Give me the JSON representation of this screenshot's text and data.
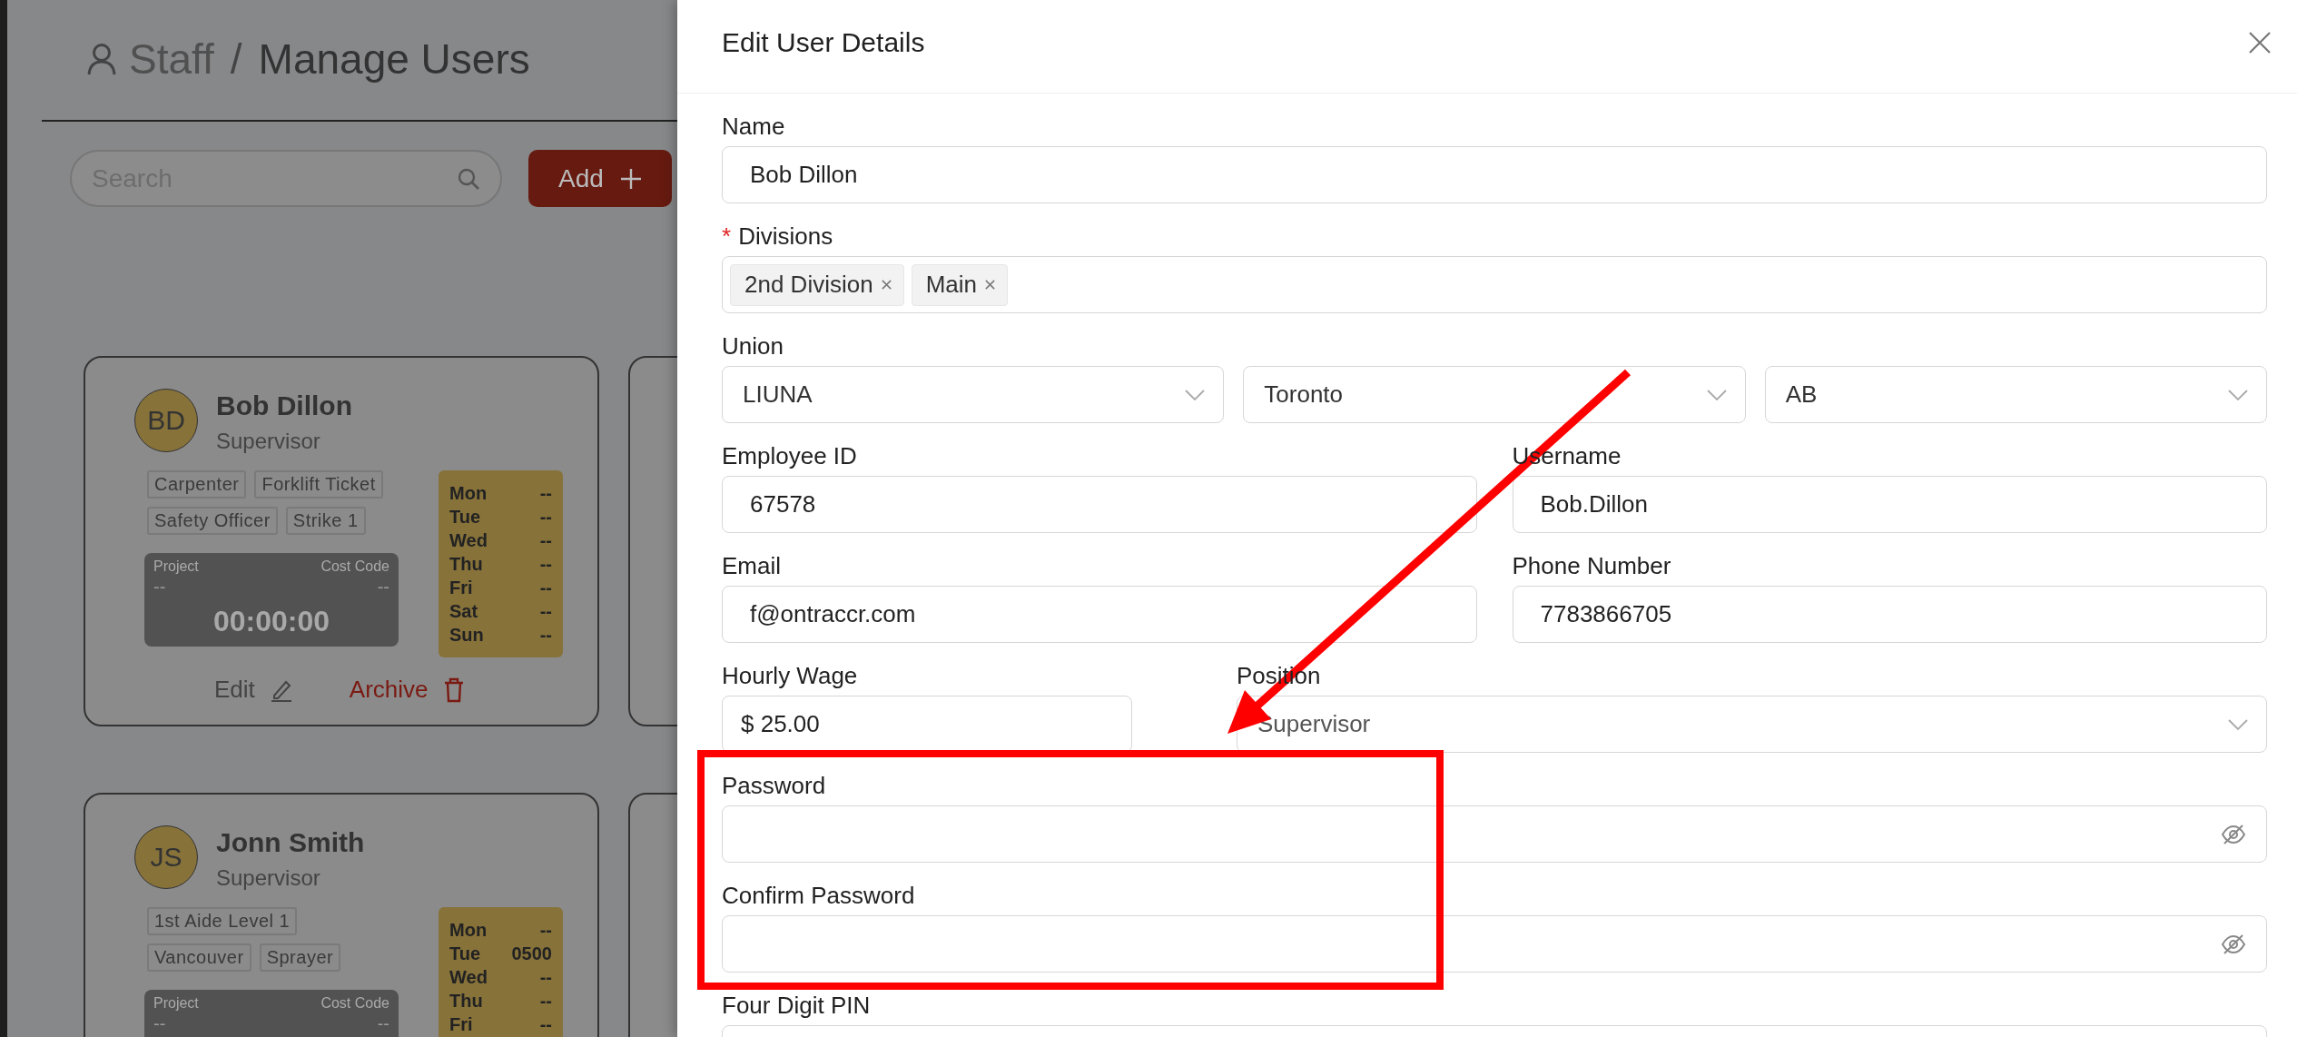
{
  "breadcrumb": {
    "section": "Staff",
    "separator": "/",
    "page": "Manage Users"
  },
  "search": {
    "placeholder": "Search"
  },
  "add_button": {
    "label": "Add"
  },
  "users": [
    {
      "initials": "BD",
      "name": "Bob Dillon",
      "role": "Supervisor",
      "tags": [
        [
          "Carpenter",
          "Forklift Ticket"
        ],
        [
          "Safety Officer",
          "Strike 1"
        ]
      ],
      "timer": {
        "project_label": "Project",
        "project": "--",
        "cost_code_label": "Cost Code",
        "cost_code": "--",
        "time": "00:00:00"
      },
      "schedule": [
        {
          "day": "Mon",
          "value": "--"
        },
        {
          "day": "Tue",
          "value": "--"
        },
        {
          "day": "Wed",
          "value": "--"
        },
        {
          "day": "Thu",
          "value": "--"
        },
        {
          "day": "Fri",
          "value": "--"
        },
        {
          "day": "Sat",
          "value": "--"
        },
        {
          "day": "Sun",
          "value": "--"
        }
      ],
      "actions": {
        "edit": "Edit",
        "archive": "Archive"
      }
    },
    {
      "initials": "JS",
      "name": "Jonn Smith",
      "role": "Supervisor",
      "tags": [
        [
          "1st Aide Level 1"
        ],
        [
          "Vancouver",
          "Sprayer"
        ]
      ],
      "timer": {
        "project_label": "Project",
        "project": "--",
        "cost_code_label": "Cost Code",
        "cost_code": "--"
      },
      "schedule": [
        {
          "day": "Mon",
          "value": "--"
        },
        {
          "day": "Tue",
          "value": "0500"
        },
        {
          "day": "Wed",
          "value": "--"
        },
        {
          "day": "Thu",
          "value": "--"
        },
        {
          "day": "Fri",
          "value": "--"
        }
      ]
    }
  ],
  "drawer": {
    "title": "Edit User Details",
    "rows": [
      {
        "cells": [
          {
            "kind": "text",
            "label": "Name",
            "value": "Bob Dillon"
          }
        ]
      },
      {
        "cells": [
          {
            "kind": "tags",
            "label": "Divisions",
            "required_mark": "*",
            "tags": [
              "2nd Division",
              "Main"
            ]
          }
        ]
      },
      {
        "cells": [
          {
            "kind": "select_group",
            "label": "Union",
            "values": [
              "LIUNA",
              "Toronto",
              "AB"
            ]
          }
        ]
      },
      {
        "cells": [
          {
            "kind": "text",
            "label": "Employee ID",
            "value": "67578"
          },
          {
            "kind": "text",
            "label": "Username",
            "value": "Bob.Dillon"
          }
        ]
      },
      {
        "cells": [
          {
            "kind": "text",
            "label": "Email",
            "value": "f@ontraccr.com"
          },
          {
            "kind": "text",
            "label": "Phone Number",
            "value": "7783866705"
          }
        ]
      },
      {
        "cells": [
          {
            "kind": "currency",
            "label": "Hourly Wage",
            "prefix": "$",
            "value": "25.00"
          },
          {
            "kind": "select",
            "label": "Position",
            "value": "Supervisor"
          }
        ]
      },
      {
        "cells": [
          {
            "kind": "password",
            "label": "Password"
          }
        ]
      },
      {
        "cells": [
          {
            "kind": "password",
            "label": "Confirm Password"
          }
        ]
      },
      {
        "cells": [
          {
            "kind": "text",
            "label": "Four Digit PIN"
          }
        ]
      }
    ]
  },
  "annotations": {
    "arrow": true,
    "highlight_box": true
  }
}
